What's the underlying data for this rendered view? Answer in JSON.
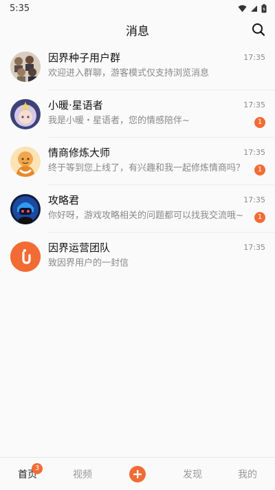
{
  "status_bar": {
    "time": "5:35"
  },
  "header": {
    "title": "消息",
    "search_icon": "search-icon"
  },
  "chats": [
    {
      "name": "因界种子用户群",
      "message": "欢迎进入群聊，游客模式仅支持浏览消息",
      "time": "17:35",
      "unread": ""
    },
    {
      "name": "小暖·星语者",
      "message": "我是小暖・星语者，您的情感陪伴~",
      "time": "17:35",
      "unread": "1"
    },
    {
      "name": "情商修炼大师",
      "message": "终于等到您上线了，有兴趣和我一起修炼情商吗？",
      "time": "17:35",
      "unread": "1"
    },
    {
      "name": "攻略君",
      "message": "你好呀，游戏攻略相关的问题都可以找我交流哦~",
      "time": "17:35",
      "unread": "1"
    },
    {
      "name": "因界运营团队",
      "message": "致因界用户的一封信",
      "time": "17:35",
      "unread": ""
    }
  ],
  "bottom_nav": {
    "home": "首页",
    "home_badge": "3",
    "video": "视频",
    "discover": "发现",
    "mine": "我的"
  },
  "colors": {
    "accent": "#f26b35"
  }
}
